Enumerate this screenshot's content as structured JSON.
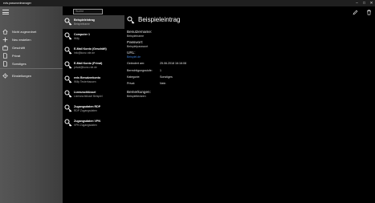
{
  "window": {
    "title": "evis.passwordmanager",
    "controls": {
      "minimize": "–",
      "maximize": "□",
      "close": "✕"
    }
  },
  "sidebar": {
    "items": [
      {
        "label": "Nicht zugeordnet",
        "icon": "home-icon"
      },
      {
        "label": "Neu erstellen",
        "icon": "add-icon"
      },
      {
        "label": "Geschäft",
        "icon": "briefcase-icon"
      },
      {
        "label": "Privat",
        "icon": "document-icon"
      },
      {
        "label": "Sonstiges",
        "icon": "document-icon"
      }
    ],
    "settings": {
      "label": "Einstellungen",
      "icon": "gear-icon"
    }
  },
  "search": {
    "placeholder": "Suche"
  },
  "entries": [
    {
      "title": "Beispieleintrag",
      "subtitle": "Beispielname",
      "selected": true
    },
    {
      "title": "Computer 1",
      "subtitle": "Willy",
      "selected": false
    },
    {
      "title": "E-Mail Konto (Geschäft)",
      "subtitle": "info@kunz-rde.de",
      "selected": false
    },
    {
      "title": "E-Mail Konto (Privat)",
      "subtitle": "privat@kunz-rde.de",
      "selected": false
    },
    {
      "title": "evis Benutzerkonto",
      "subtitle": "Willy Testerhausen",
      "selected": false
    },
    {
      "title": "Lizenzschlüssel",
      "subtitle": "Lizenzschlüssel Beispiel",
      "selected": false
    },
    {
      "title": "Zugangsdaten RDP",
      "subtitle": "RDP Zugangsdaten",
      "selected": false
    },
    {
      "title": "Zugangsdaten VPN",
      "subtitle": "VPN Zugangsdaten",
      "selected": false
    }
  ],
  "detail": {
    "title": "Beispieleintrag",
    "username_label": "Benutzername:",
    "username_value": "Beispielname",
    "password_label": "Passwort:",
    "password_value": "Beispielpasswort",
    "url_label": "URL:",
    "url_value": "Beispiel.de",
    "rows": [
      {
        "label": "Geändert am:",
        "value": "25.06.2018 16:16:08"
      },
      {
        "label": "Berechtigungsstufe:",
        "value": "1"
      },
      {
        "label": "Kategorie:",
        "value": "Sonstiges"
      },
      {
        "label": "Privat:",
        "value": "Nein"
      }
    ],
    "remarks_label": "Bemerkungen:",
    "remarks_value": "Beispieltextzen"
  },
  "colors": {
    "accent": "#3d7fd6",
    "sidebar": "#4c4c4c",
    "selected": "#3a3a3a"
  }
}
